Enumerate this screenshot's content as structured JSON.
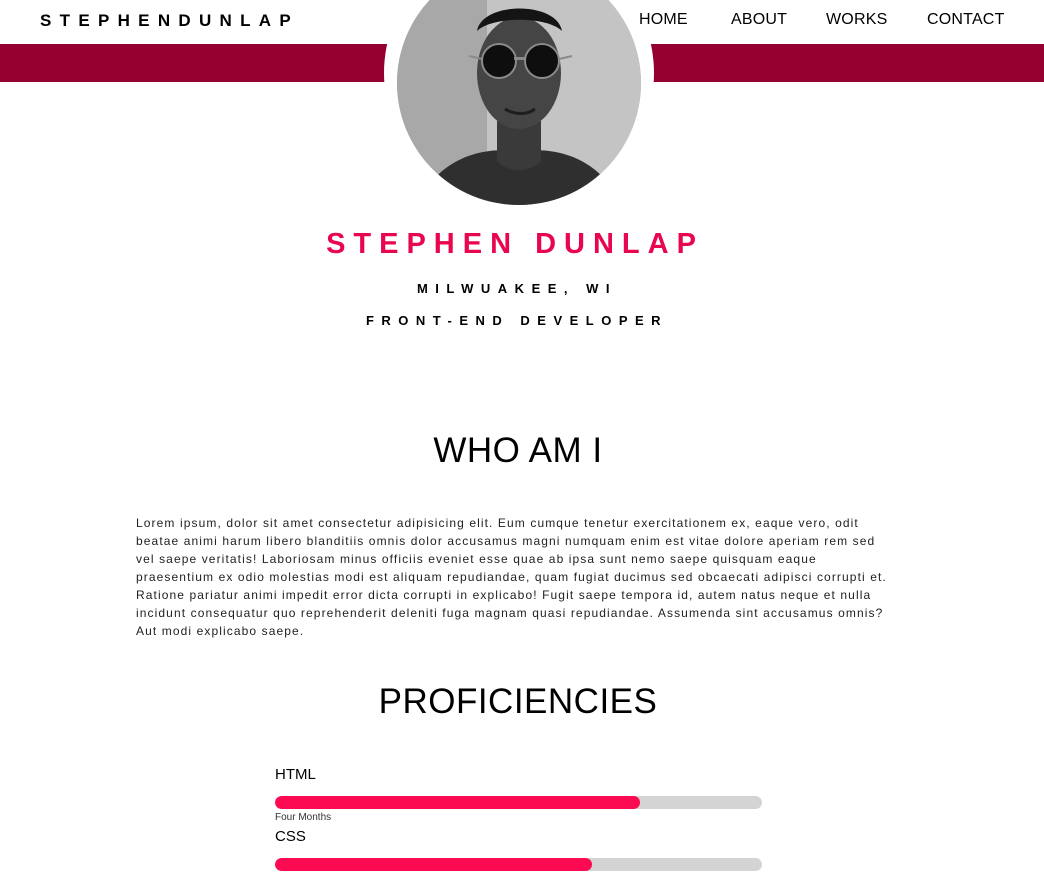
{
  "header": {
    "brand": "STEPHENDUNLAP",
    "nav": [
      {
        "label": "HOME"
      },
      {
        "label": "ABOUT"
      },
      {
        "label": "WORKS"
      },
      {
        "label": "CONTACT"
      }
    ]
  },
  "profile": {
    "name": "STEPHEN DUNLAP",
    "location": "MILWUAKEE, WI",
    "role": "FRONT-END DEVELOPER",
    "avatar_icon": "profile-photo"
  },
  "about": {
    "title": "WHO AM I",
    "body": "Lorem ipsum, dolor sit amet consectetur adipisicing elit. Eum cumque tenetur exercitationem ex, eaque vero, odit beatae animi harum libero blanditiis omnis dolor accusamus magni numquam enim est vitae dolore aperiam rem sed vel saepe veritatis! Laboriosam minus officiis eveniet esse quae ab ipsa sunt nemo saepe quisquam eaque praesentium ex odio molestias modi est aliquam repudiandae, quam fugiat ducimus sed obcaecati adipisci corrupti et. Ratione pariatur animi impedit error dicta corrupti in explicabo! Fugit saepe tempora id, autem natus neque et nulla incidunt consequatur quo reprehenderit deleniti fuga magnam quasi repudiandae. Assumenda sint accusamus omnis? Aut modi explicabo saepe."
  },
  "proficiencies": {
    "title": "PROFICIENCIES",
    "skills": [
      {
        "name": "HTML",
        "level": 0.75,
        "note": "Four Months"
      },
      {
        "name": "CSS",
        "level": 0.65,
        "note": ""
      }
    ]
  },
  "colors": {
    "accent": "#e8064f",
    "band": "#960030",
    "bar_fill": "#fc0a52",
    "bar_track": "#d4d4d4"
  }
}
